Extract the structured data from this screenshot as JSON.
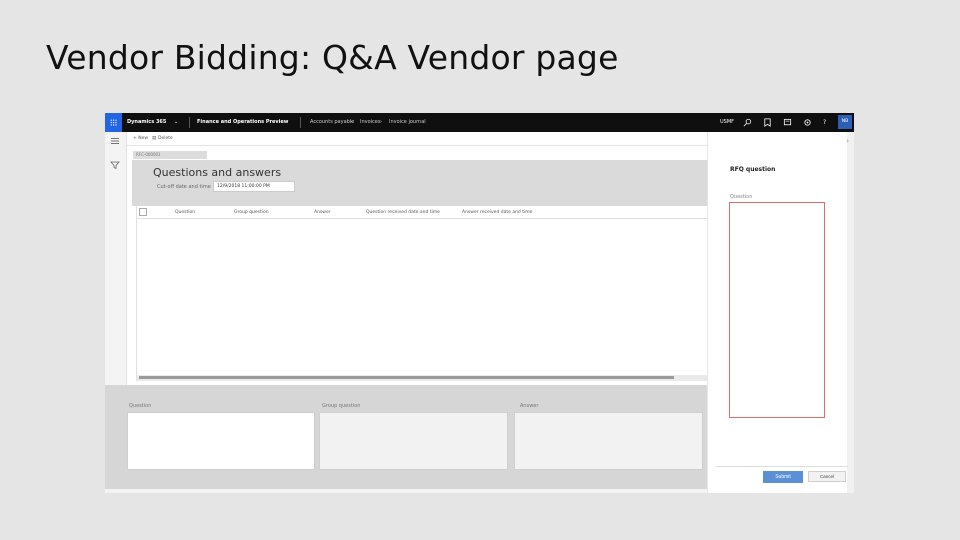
{
  "slide": {
    "title": "Vendor Bidding: Q&A Vendor page"
  },
  "navbar": {
    "app_name": "Dynamics 365",
    "module": "Finance and Operations Preview",
    "breadcrumbs": [
      "Accounts payable",
      "Invoices",
      "Invoice journal"
    ],
    "company": "USMF",
    "avatar_initials": "NB"
  },
  "actionbar": {
    "new_label": "+ New",
    "delete_label": "Delete"
  },
  "record": {
    "rfq_id": "RFC-000001"
  },
  "header": {
    "title": "Questions and answers",
    "cutoff_label": "Cut-off date and time",
    "cutoff_value": "12/9/2018 11:00:00 PM"
  },
  "grid": {
    "columns": [
      "Question",
      "Group question",
      "Answer",
      "Question received date and time",
      "Answer received date and time"
    ]
  },
  "details": {
    "fields": [
      "Question",
      "Group question",
      "Answer"
    ]
  },
  "pane": {
    "title": "RFQ question",
    "question_label": "Question",
    "submit_label": "Submit",
    "cancel_label": "Cancel"
  },
  "colors": {
    "accent": "#2266e3",
    "navbar": "#0f0f0f",
    "submit": "#5b8fd6",
    "field_error_border": "#e06b6b"
  }
}
